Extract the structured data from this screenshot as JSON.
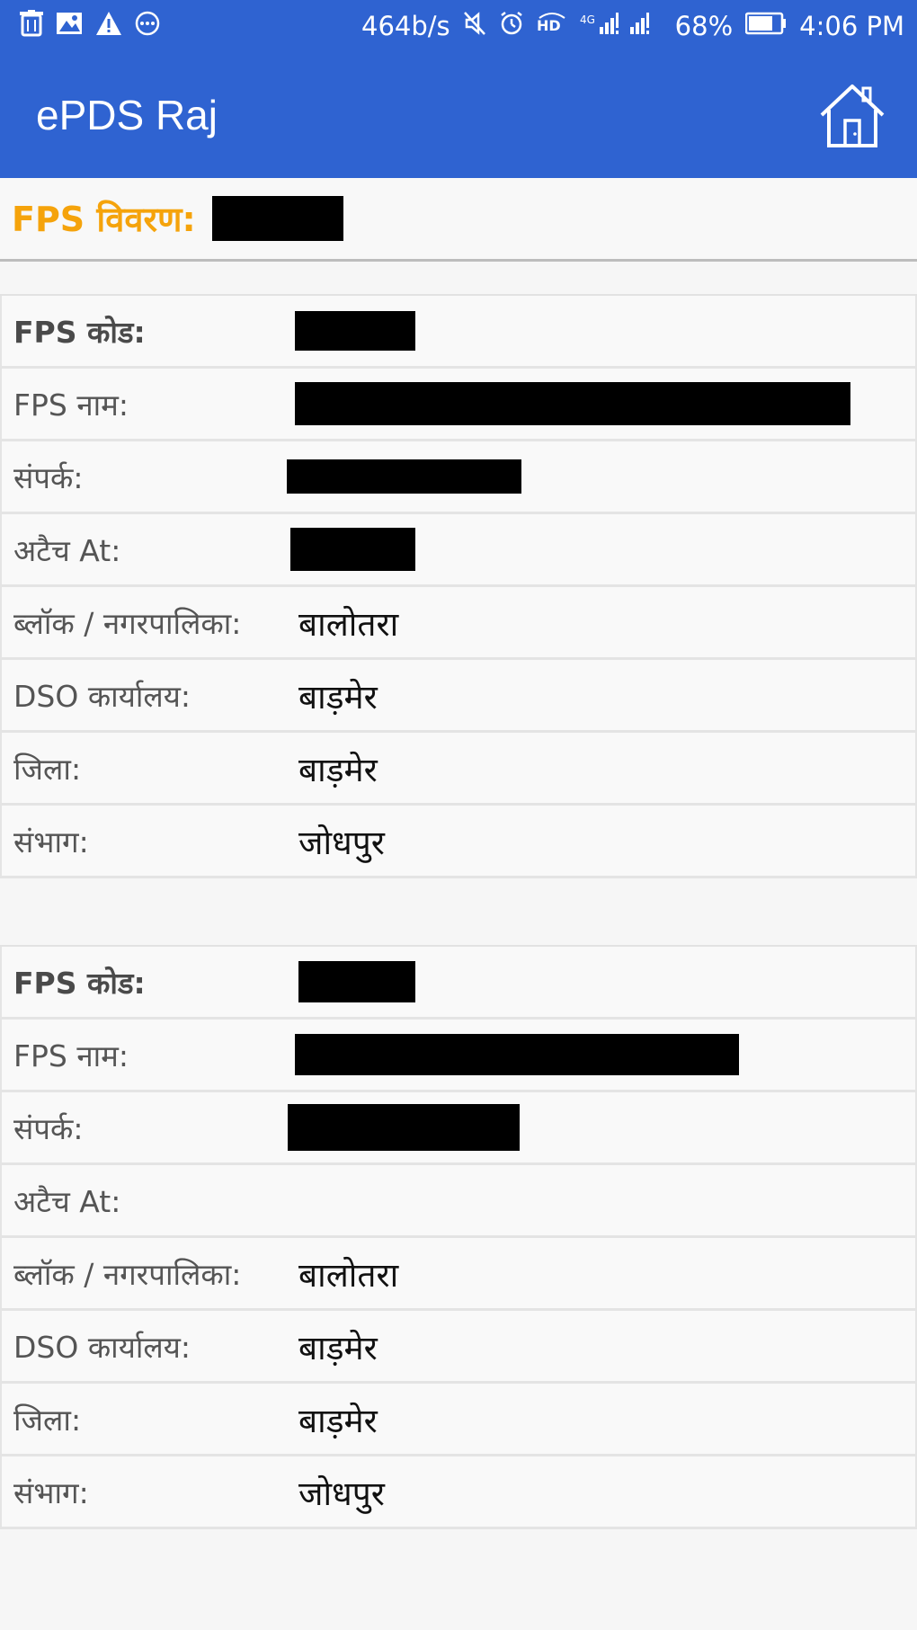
{
  "status_bar": {
    "speed": "464b/s",
    "battery_percent": "68%",
    "time": "4:06 PM",
    "icons": [
      "trash-icon",
      "image-icon",
      "warning-icon",
      "more-icon",
      "mute-icon",
      "alarm-icon",
      "hd-icon",
      "signal-icon",
      "battery-icon"
    ]
  },
  "app_bar": {
    "title": "ePDS Raj",
    "home_icon": "home-icon"
  },
  "header": {
    "label": "FPS विवरण:"
  },
  "cards": [
    {
      "rows": [
        {
          "label": "FPS कोड:",
          "value": "",
          "redacted": true
        },
        {
          "label": "FPS नाम:",
          "value": "",
          "redacted": true
        },
        {
          "label": "संपर्क:",
          "value": "",
          "redacted": true
        },
        {
          "label": "अटैच At:",
          "value": "",
          "redacted": true
        },
        {
          "label": "ब्लॉक / नगरपालिका:",
          "value": "बालोतरा"
        },
        {
          "label": "DSO कार्यालय:",
          "value": "बाड़मेर"
        },
        {
          "label": "जिला:",
          "value": "बाड़मेर"
        },
        {
          "label": "संभाग:",
          "value": "जोधपुर"
        }
      ]
    },
    {
      "rows": [
        {
          "label": "FPS कोड:",
          "value": "",
          "redacted": true
        },
        {
          "label": "FPS नाम:",
          "value": "",
          "redacted": true
        },
        {
          "label": "संपर्क:",
          "value": "",
          "redacted": true
        },
        {
          "label": "अटैच At:",
          "value": ""
        },
        {
          "label": "ब्लॉक / नगरपालिका:",
          "value": "बालोतरा"
        },
        {
          "label": "DSO कार्यालय:",
          "value": "बाड़मेर"
        },
        {
          "label": "जिला:",
          "value": "बाड़मेर"
        },
        {
          "label": "संभाग:",
          "value": "जोधपुर"
        }
      ]
    }
  ],
  "colors": {
    "primary": "#2f63d1",
    "accent": "#f5a30b"
  }
}
